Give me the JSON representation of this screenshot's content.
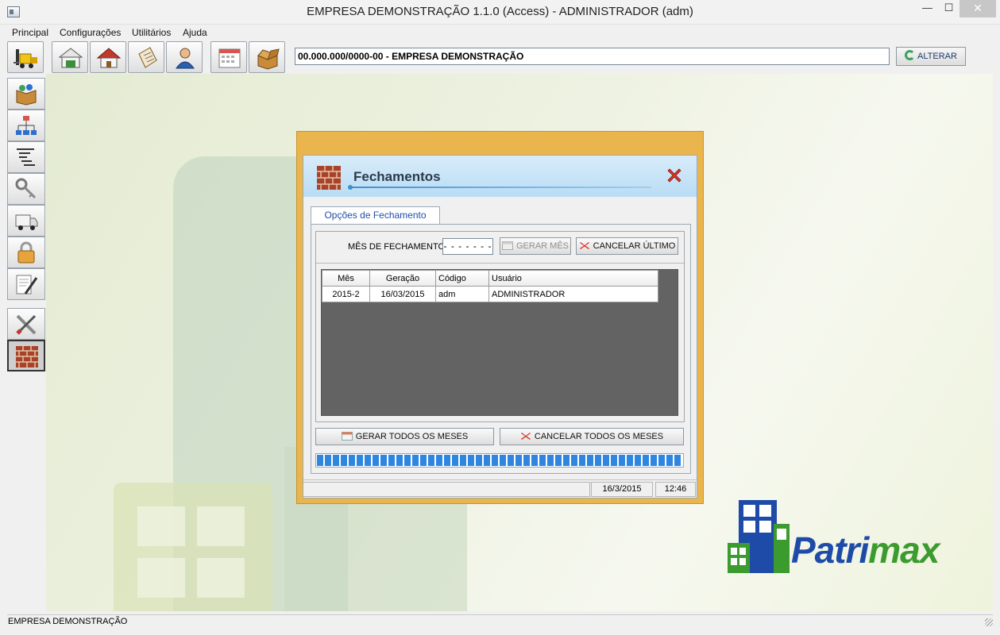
{
  "window": {
    "title": "EMPRESA DEMONSTRAÇÃO 1.1.0 (Access) - ADMINISTRADOR (adm)",
    "minimize": "—",
    "maximize": "☐",
    "close": "✕"
  },
  "menu": {
    "items": [
      "Principal",
      "Configurações",
      "Utilitários",
      "Ajuda"
    ]
  },
  "toolbar": {
    "company_value": "00.000.000/0000-00 - EMPRESA DEMONSTRAÇÃO",
    "alterar_label": "ALTERAR",
    "icons": [
      "forklift-icon",
      "warehouse-icon",
      "home-icon",
      "clipboard-icon",
      "user-icon",
      "calendar-icon",
      "open-box-icon"
    ]
  },
  "sidebar": {
    "icons": [
      "boxes-icon",
      "org-chart-icon",
      "tree-list-icon",
      "keys-icon",
      "truck-icon",
      "padlock-icon",
      "document-pen-icon",
      "tools-icon",
      "brick-wall-icon"
    ]
  },
  "dialog": {
    "title": "Fechamentos",
    "tab_label": "Opções de Fechamento",
    "mes_label": "MÊS DE FECHAMENTO:",
    "mes_value": "- - - - - - -",
    "gerar_mes_label": "GERAR MÊS",
    "cancelar_ultimo_label": "CANCELAR ÚLTIMO",
    "grid": {
      "columns": [
        "Mês",
        "Geração",
        "Código",
        "Usuário"
      ],
      "rows": [
        [
          "2015-2",
          "16/03/2015",
          "adm",
          "ADMINISTRADOR"
        ]
      ]
    },
    "gerar_todos_label": "GERAR TODOS OS MESES",
    "cancelar_todos_label": "CANCELAR TODOS OS MESES",
    "progress": 1.0,
    "status_date": "16/3/2015",
    "status_time": "12:46"
  },
  "logo": {
    "text_a": "Patri",
    "text_b": "max"
  },
  "statusbar": {
    "text": "EMPRESA DEMONSTRAÇÃO"
  },
  "colors": {
    "dialog_frame": "#e9b54c",
    "dialog_header": "#c9e4f8",
    "progress": "#2f86e0",
    "logo_blue": "#1e4aa8",
    "logo_green": "#3b9b2f"
  }
}
